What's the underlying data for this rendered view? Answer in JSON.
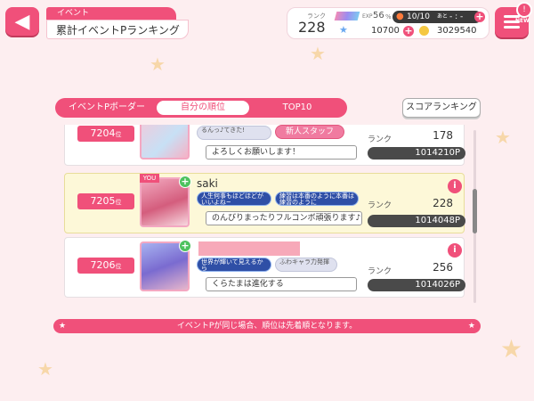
{
  "header": {
    "category": "イベント",
    "title": "累計イベントPランキング"
  },
  "status": {
    "rank_label": "ランク",
    "rank": "228",
    "exp_label": "EXP",
    "exp_percent": "56",
    "exp_unit": "%",
    "stamina": "10/10",
    "stamina_suffix": "あと",
    "stamina_timer": "- : -",
    "star_gems": "10700",
    "coins": "3029540"
  },
  "menu": {
    "new_badge": "NEW"
  },
  "tabs": [
    {
      "label": "イベントPボーダー"
    },
    {
      "label": "自分の順位"
    },
    {
      "label": "TOP10"
    }
  ],
  "score_ranking_label": "スコアランキング",
  "rows": [
    {
      "rank": "7204",
      "rank_unit": "位",
      "comment": "よろしくお願いします！",
      "badge1": "るんっ♪てきた!",
      "badge2": "新人スタッフ",
      "rank_label": "ランク",
      "player_rank": "178",
      "points": "1014210P"
    },
    {
      "rank": "7205",
      "rank_unit": "位",
      "you_label": "YOU",
      "name": "saki",
      "badge1": "人生何事もほどほどがいいよね~",
      "badge2": "練習は本番のように本番は練習のように",
      "comment": "のんびりまったりフルコンボ頑張ります♪",
      "rank_label": "ランク",
      "player_rank": "228",
      "points": "1014048P"
    },
    {
      "rank": "7206",
      "rank_unit": "位",
      "badge1": "世界が輝いて見えるから",
      "badge2": "ふわキャラ力発揮",
      "comment": "くらたまは進化する",
      "rank_label": "ランク",
      "player_rank": "256",
      "points": "1014026P"
    }
  ],
  "notice": "イベントPが同じ場合、順位は先着順となります。",
  "colors": {
    "accent": "#f0507a",
    "background": "#fdeef0",
    "my_row": "#fdf8d8"
  }
}
